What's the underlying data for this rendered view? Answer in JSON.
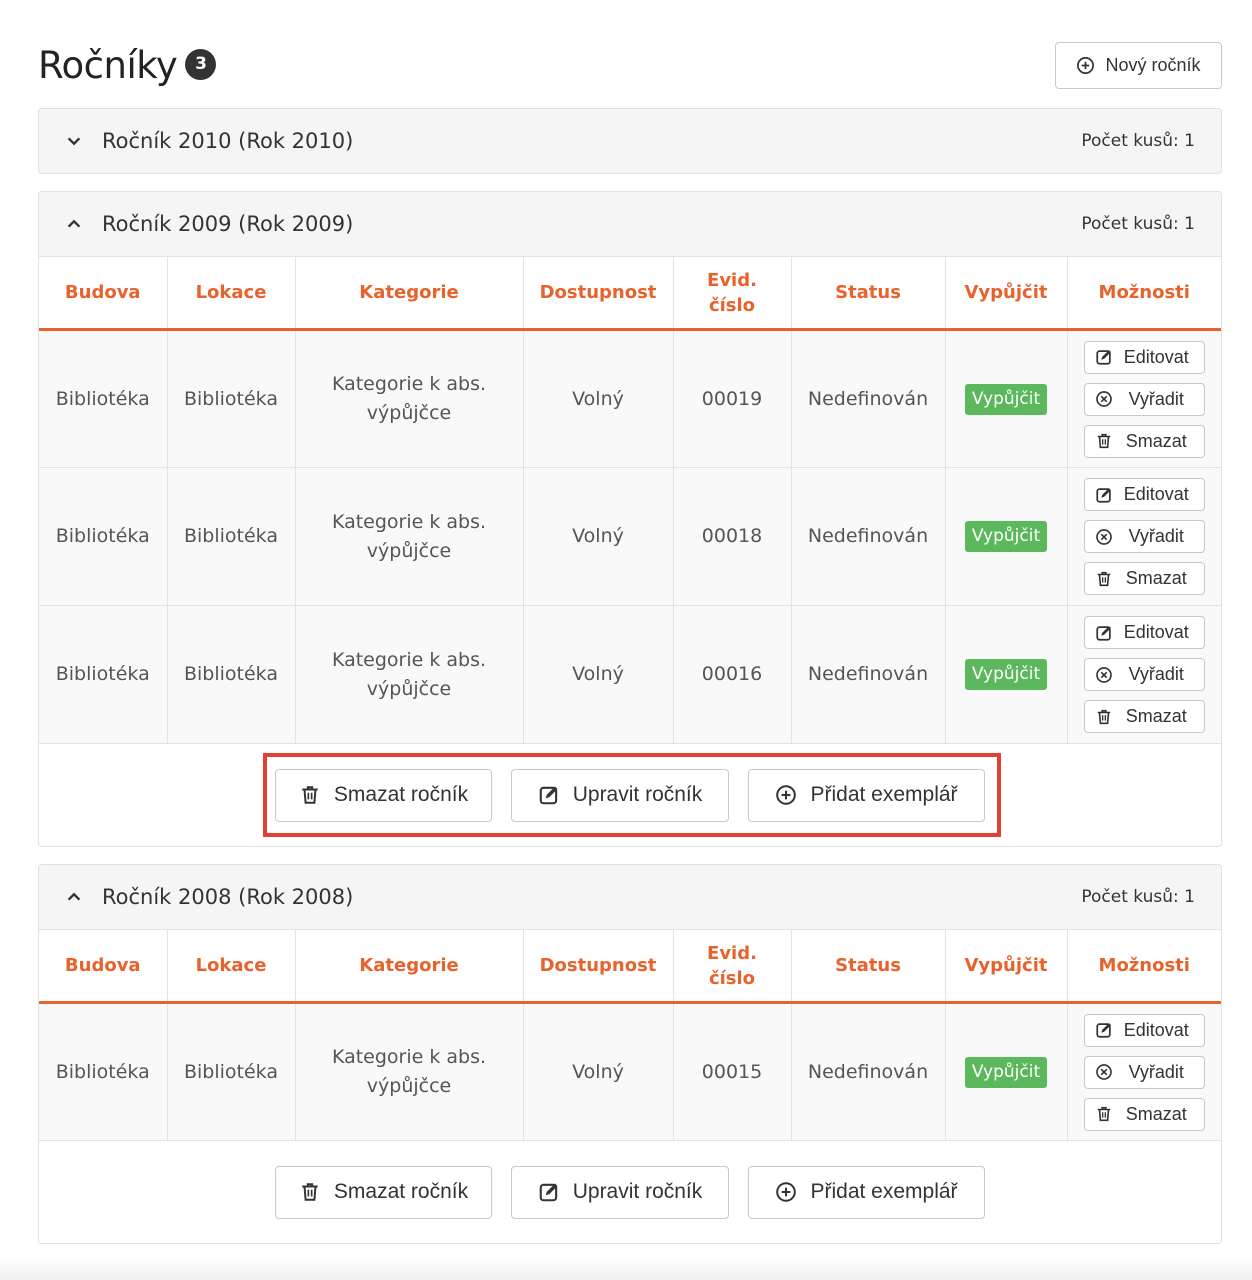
{
  "header": {
    "title": "Ročníky",
    "count": "3",
    "new_button": "Nový ročník"
  },
  "columns": [
    "Budova",
    "Lokace",
    "Kategorie",
    "Dostupnost",
    "Evid. číslo",
    "Status",
    "Vypůjčit",
    "Možnosti"
  ],
  "options": {
    "edit": "Editovat",
    "discard": "Vyřadit",
    "delete": "Smazat"
  },
  "footer_buttons": {
    "delete": "Smazat ročník",
    "edit": "Upravit ročník",
    "add": "Přidat exemplář"
  },
  "panels": [
    {
      "title": "Ročník 2010 (Rok 2010)",
      "count_label": "Počet kusů: 1",
      "expanded": false,
      "rows": []
    },
    {
      "title": "Ročník 2009 (Rok 2009)",
      "count_label": "Počet kusů: 1",
      "expanded": true,
      "highlighted_footer": true,
      "rows": [
        {
          "budova": "Bibliotéka",
          "lokace": "Bibliotéka",
          "kategorie": "Kategorie k abs. výpůjčce",
          "dostupnost": "Volný",
          "evid": "00019",
          "status": "Nedefinován",
          "lend": "Vypůjčit"
        },
        {
          "budova": "Bibliotéka",
          "lokace": "Bibliotéka",
          "kategorie": "Kategorie k abs. výpůjčce",
          "dostupnost": "Volný",
          "evid": "00018",
          "status": "Nedefinován",
          "lend": "Vypůjčit"
        },
        {
          "budova": "Bibliotéka",
          "lokace": "Bibliotéka",
          "kategorie": "Kategorie k abs. výpůjčce",
          "dostupnost": "Volný",
          "evid": "00016",
          "status": "Nedefinován",
          "lend": "Vypůjčit"
        }
      ]
    },
    {
      "title": "Ročník 2008 (Rok 2008)",
      "count_label": "Počet kusů: 1",
      "expanded": true,
      "highlighted_footer": false,
      "rows": [
        {
          "budova": "Bibliotéka",
          "lokace": "Bibliotéka",
          "kategorie": "Kategorie k abs. výpůjčce",
          "dostupnost": "Volný",
          "evid": "00015",
          "status": "Nedefinován",
          "lend": "Vypůjčit"
        }
      ]
    }
  ],
  "colors": {
    "accent": "#e8622c",
    "success": "#5cb85c",
    "highlight": "#e5402f"
  },
  "icons": {
    "new": "plus-circle-icon",
    "expand": "chevron-down-icon",
    "collapse": "chevron-up-icon",
    "edit": "edit-icon",
    "discard": "x-circle-icon",
    "delete": "trash-icon",
    "add": "plus-circle-icon"
  }
}
